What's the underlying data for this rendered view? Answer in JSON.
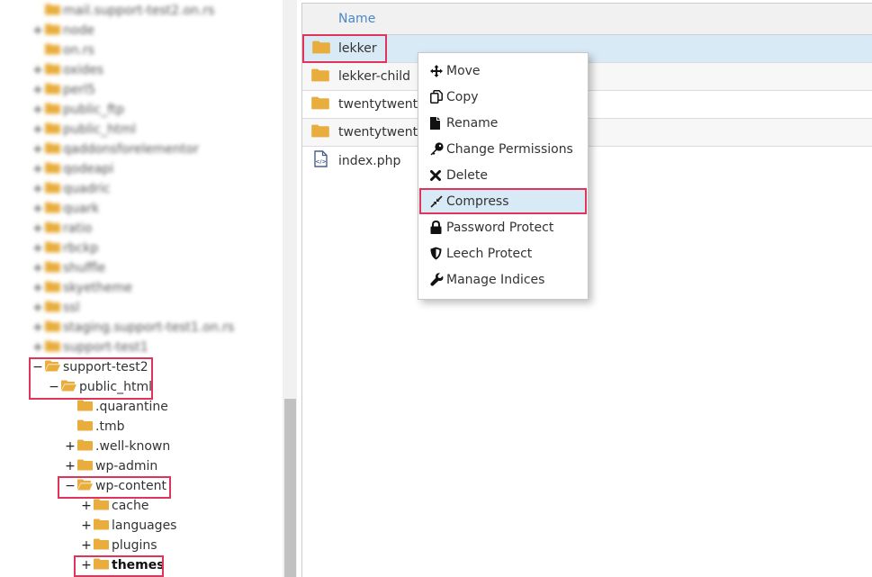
{
  "tree": {
    "blurred_items": [
      {
        "label": "mail.support-test2.on.rs",
        "expander": ""
      },
      {
        "label": "node",
        "expander": "+"
      },
      {
        "label": "on.rs",
        "expander": ""
      },
      {
        "label": "oxides",
        "expander": "+"
      },
      {
        "label": "perl5",
        "expander": "+"
      },
      {
        "label": "public_ftp",
        "expander": "+"
      },
      {
        "label": "public_html",
        "expander": "+"
      },
      {
        "label": "qaddonsforelementor",
        "expander": "+"
      },
      {
        "label": "qodeapi",
        "expander": "+"
      },
      {
        "label": "quadric",
        "expander": "+"
      },
      {
        "label": "quark",
        "expander": "+"
      },
      {
        "label": "ratio",
        "expander": "+"
      },
      {
        "label": "rbckp",
        "expander": "+"
      },
      {
        "label": "shuffle",
        "expander": "+"
      },
      {
        "label": "skyetheme",
        "expander": "+"
      },
      {
        "label": "ssl",
        "expander": "+"
      },
      {
        "label": "staging.support-test1.on.rs",
        "expander": "+"
      },
      {
        "label": "support-test1",
        "expander": "+"
      }
    ],
    "items": [
      {
        "label": "support-test2",
        "expander": "−",
        "open": true
      },
      {
        "label": "public_html",
        "expander": "−",
        "open": true
      },
      {
        "label": ".quarantine",
        "expander": ""
      },
      {
        "label": ".tmb",
        "expander": ""
      },
      {
        "label": ".well-known",
        "expander": "+"
      },
      {
        "label": "wp-admin",
        "expander": "+"
      },
      {
        "label": "wp-content",
        "expander": "−",
        "open": true
      },
      {
        "label": "cache",
        "expander": "+"
      },
      {
        "label": "languages",
        "expander": "+"
      },
      {
        "label": "plugins",
        "expander": "+"
      },
      {
        "label": "themes",
        "expander": "+",
        "current": true
      }
    ]
  },
  "file_list": {
    "column_name": "Name",
    "rows": [
      {
        "name": "lekker",
        "type": "folder",
        "selected": true
      },
      {
        "name": "lekker-child",
        "type": "folder"
      },
      {
        "name": "twentytwenty",
        "type": "folder"
      },
      {
        "name": "twentytwentyone",
        "type": "folder"
      },
      {
        "name": "index.php",
        "type": "php-file"
      }
    ]
  },
  "context_menu": {
    "items": [
      {
        "label": "Move",
        "icon": "move-icon"
      },
      {
        "label": "Copy",
        "icon": "copy-icon"
      },
      {
        "label": "Rename",
        "icon": "file-icon"
      },
      {
        "label": "Change Permissions",
        "icon": "key-icon"
      },
      {
        "label": "Delete",
        "icon": "x-icon"
      },
      {
        "label": "Compress",
        "icon": "compress-icon",
        "active": true
      },
      {
        "label": "Password Protect",
        "icon": "lock-icon"
      },
      {
        "label": "Leech Protect",
        "icon": "shield-icon"
      },
      {
        "label": "Manage Indices",
        "icon": "wrench-icon"
      }
    ]
  },
  "colors": {
    "folder": "#e8ad3c",
    "highlight_border": "#e0345a",
    "selected_row": "#d9eaf7",
    "header_link": "#4a88c7"
  }
}
